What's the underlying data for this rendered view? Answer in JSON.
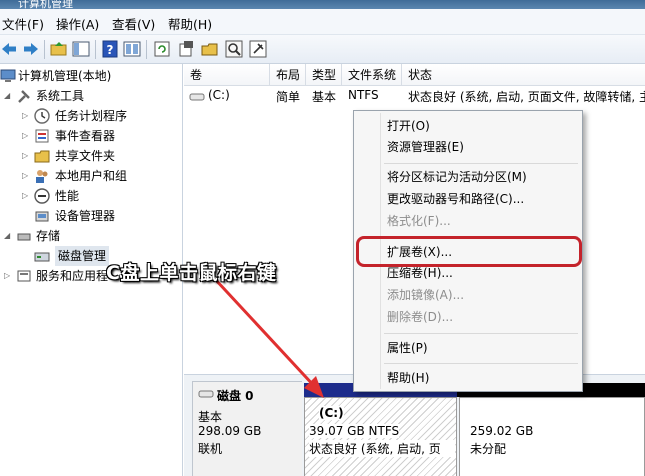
{
  "window": {
    "title": "计算机管理"
  },
  "menu": [
    "文件(F)",
    "操作(A)",
    "查看(V)",
    "帮助(H)"
  ],
  "toolbar": {
    "icons": [
      "back-icon",
      "forward-icon",
      "up-folder-icon",
      "show-tree-icon",
      "help-icon",
      "help-book-icon",
      "refresh-icon",
      "properties-icon",
      "open-icon",
      "search-icon",
      "disk-settings-icon"
    ]
  },
  "tree": {
    "root": "计算机管理(本地)",
    "system_tools": "系统工具",
    "task_scheduler": "任务计划程序",
    "event_viewer": "事件查看器",
    "shared_folders": "共享文件夹",
    "local_users": "本地用户和组",
    "performance": "性能",
    "device_manager": "设备管理器",
    "storage": "存储",
    "disk_management": "磁盘管理",
    "services": "服务和应用程"
  },
  "volumes": {
    "headers": [
      "卷",
      "布局",
      "类型",
      "文件系统",
      "状态"
    ],
    "rows": [
      {
        "volume": "(C:)",
        "layout": "简单",
        "type": "基本",
        "fs": "NTFS",
        "status": "状态良好 (系统, 启动, 页面文件, 故障转储, 主"
      }
    ]
  },
  "disk": {
    "name": "磁盘 0",
    "type": "基本",
    "size": "298.09 GB",
    "state": "联机",
    "partitions": [
      {
        "label": "(C:)",
        "size": "39.07 GB NTFS",
        "status": "状态良好 (系统, 启动, 页"
      },
      {
        "label": "",
        "size": "259.02 GB",
        "status": "未分配"
      }
    ]
  },
  "context_menu": {
    "open": "打开(O)",
    "explorer": "资源管理器(E)",
    "mark_active": "将分区标记为活动分区(M)",
    "change_letter": "更改驱动器号和路径(C)...",
    "format": "格式化(F)...",
    "extend": "扩展卷(X)...",
    "shrink": "压缩卷(H)...",
    "add_mirror": "添加镜像(A)...",
    "delete": "删除卷(D)...",
    "properties": "属性(P)",
    "help": "帮助(H)"
  },
  "annotation": "C盘上单击鼠标右键",
  "colors": {
    "highlight_box": "#c4232b",
    "arrow": "#e03030",
    "disk_bar": "#1d2c8c"
  }
}
